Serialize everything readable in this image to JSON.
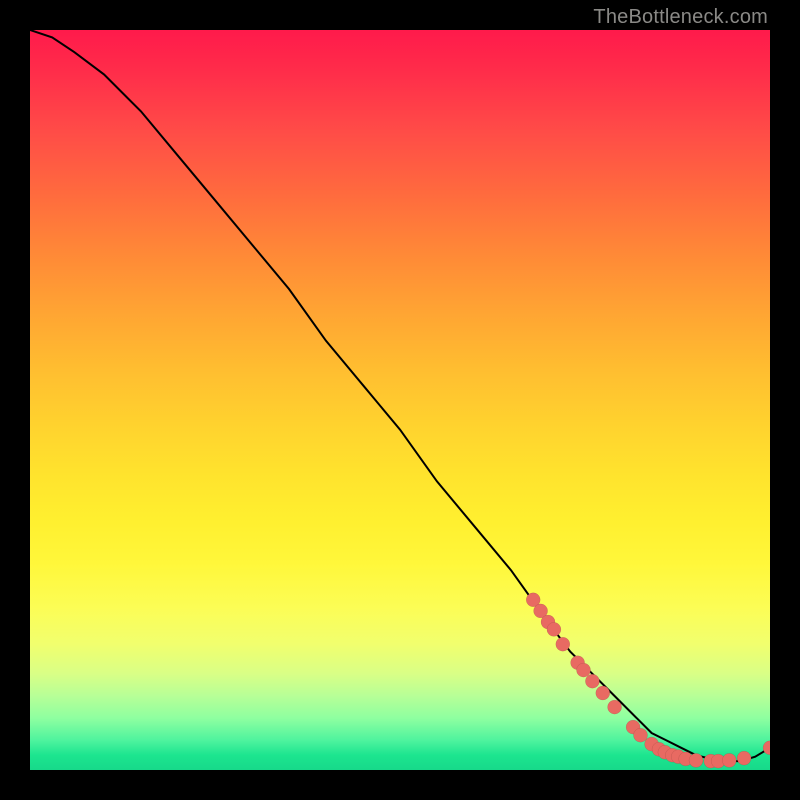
{
  "watermark": "TheBottleneck.com",
  "colors": {
    "dot": "#e86a62",
    "curve": "#000000",
    "backgroundFrame": "#000000"
  },
  "chart_data": {
    "type": "line",
    "title": "",
    "xlabel": "",
    "ylabel": "",
    "xlim": [
      0,
      100
    ],
    "ylim": [
      0,
      100
    ],
    "grid": false,
    "series": [
      {
        "name": "bottleneck-curve",
        "x": [
          0,
          3,
          6,
          10,
          15,
          20,
          25,
          30,
          35,
          40,
          45,
          50,
          55,
          60,
          65,
          70,
          73,
          76,
          79,
          82,
          84,
          86,
          88,
          90,
          92,
          94,
          96,
          98,
          100
        ],
        "y": [
          100,
          99,
          97,
          94,
          89,
          83,
          77,
          71,
          65,
          58,
          52,
          46,
          39,
          33,
          27,
          20,
          16,
          13,
          10,
          7,
          5,
          4,
          3,
          2,
          1.5,
          1.2,
          1.2,
          1.8,
          3
        ]
      }
    ],
    "scatter": {
      "name": "gpu-points",
      "points": [
        {
          "x": 68,
          "y": 23
        },
        {
          "x": 69,
          "y": 21.5
        },
        {
          "x": 70,
          "y": 20
        },
        {
          "x": 70.8,
          "y": 19
        },
        {
          "x": 72,
          "y": 17
        },
        {
          "x": 74,
          "y": 14.5
        },
        {
          "x": 74.8,
          "y": 13.5
        },
        {
          "x": 76,
          "y": 12
        },
        {
          "x": 77.4,
          "y": 10.4
        },
        {
          "x": 79,
          "y": 8.5
        },
        {
          "x": 81.5,
          "y": 5.8
        },
        {
          "x": 82.5,
          "y": 4.7
        },
        {
          "x": 84,
          "y": 3.5
        },
        {
          "x": 85,
          "y": 2.8
        },
        {
          "x": 85.8,
          "y": 2.4
        },
        {
          "x": 86.8,
          "y": 2
        },
        {
          "x": 87.6,
          "y": 1.8
        },
        {
          "x": 88.6,
          "y": 1.5
        },
        {
          "x": 90,
          "y": 1.3
        },
        {
          "x": 92,
          "y": 1.2
        },
        {
          "x": 93,
          "y": 1.2
        },
        {
          "x": 94.5,
          "y": 1.3
        },
        {
          "x": 96.5,
          "y": 1.6
        },
        {
          "x": 100,
          "y": 3
        }
      ]
    }
  }
}
